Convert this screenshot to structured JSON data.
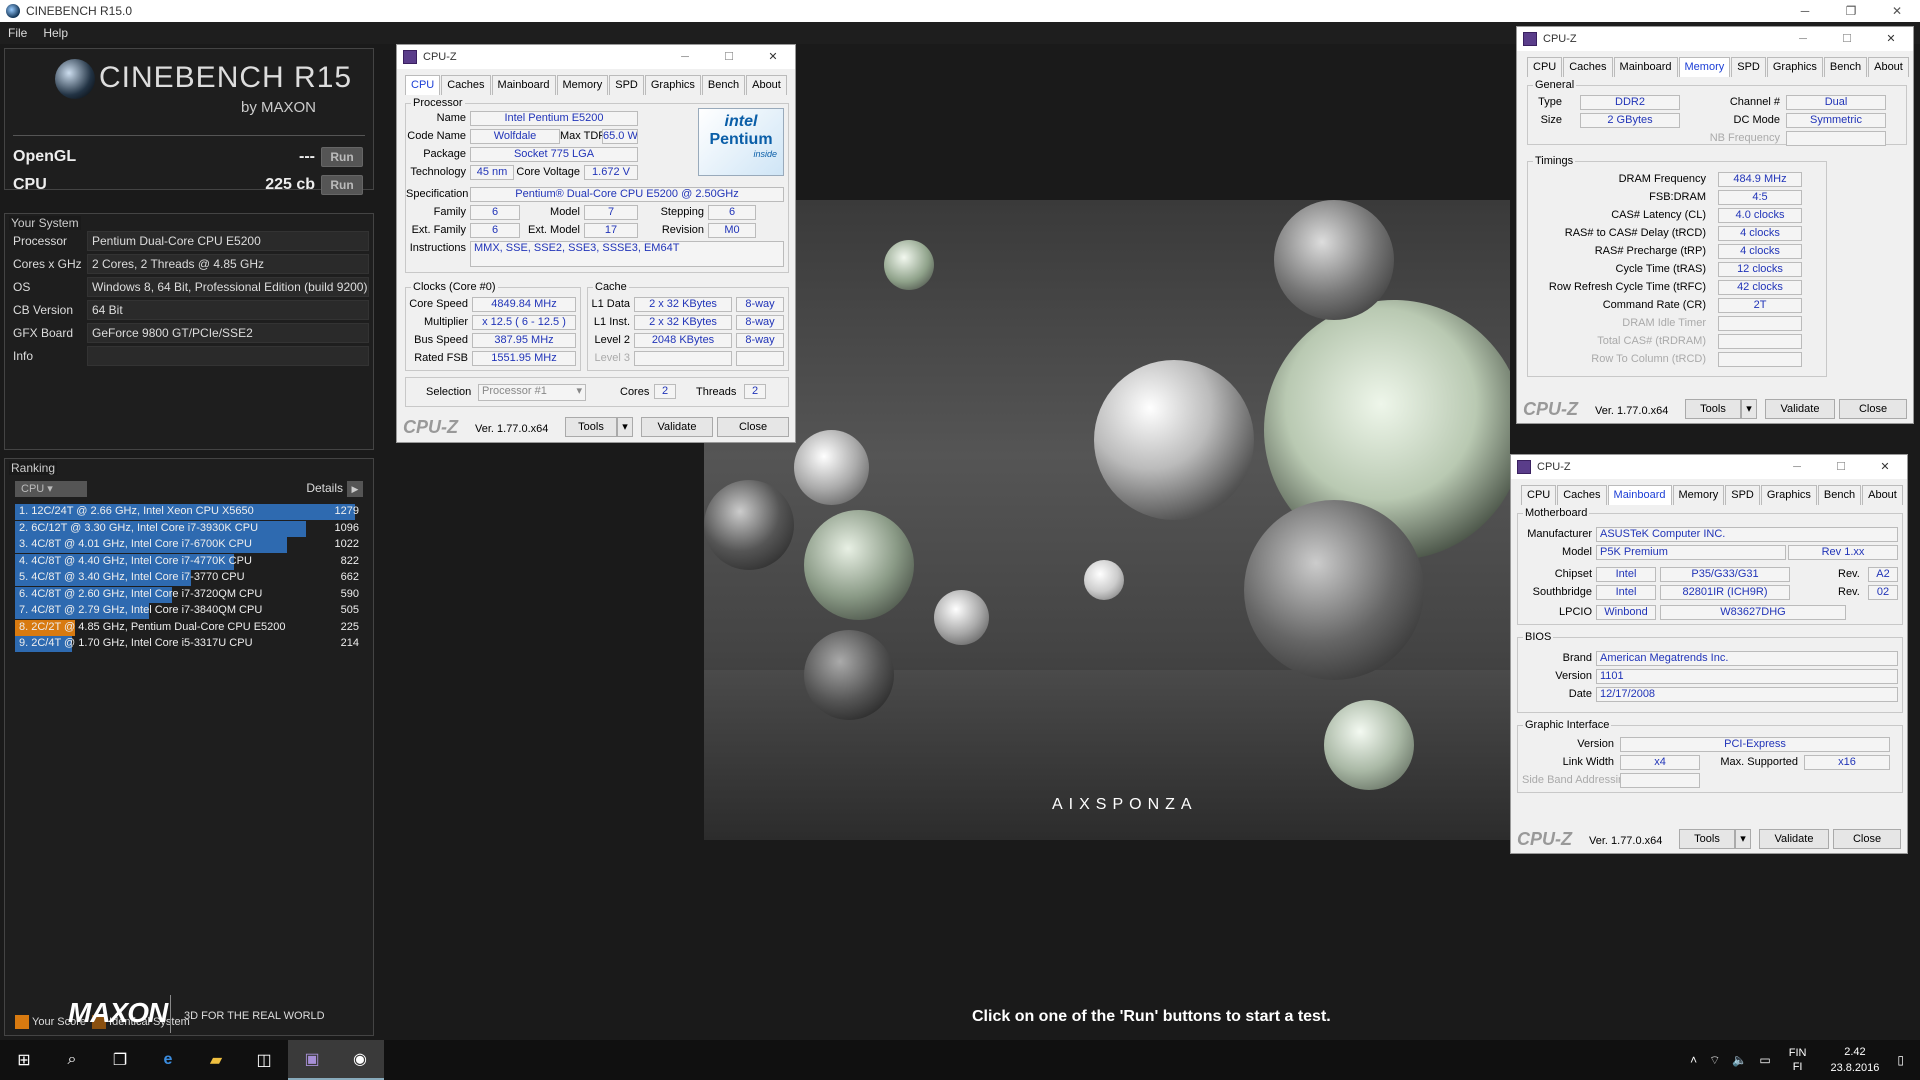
{
  "window_title": "CINEBENCH R15.0",
  "menu": [
    "File",
    "Help"
  ],
  "logo": {
    "name": "CINEBENCH R15",
    "by": "by MAXON"
  },
  "scores": [
    {
      "label": "OpenGL",
      "value": "---",
      "button": "Run"
    },
    {
      "label": "CPU",
      "value": "225 cb",
      "button": "Run"
    }
  ],
  "your_system": {
    "title": "Your System",
    "rows": [
      {
        "k": "Processor",
        "v": "Pentium Dual-Core CPU E5200"
      },
      {
        "k": "Cores x GHz",
        "v": "2 Cores, 2 Threads @ 4.85 GHz"
      },
      {
        "k": "OS",
        "v": "Windows 8, 64 Bit, Professional Edition (build 9200)"
      },
      {
        "k": "CB Version",
        "v": "64 Bit"
      },
      {
        "k": "GFX Board",
        "v": "GeForce 9800 GT/PCIe/SSE2"
      },
      {
        "k": "Info",
        "v": ""
      }
    ]
  },
  "ranking": {
    "title": "Ranking",
    "select": "CPU",
    "details": "Details",
    "max_score": 1279,
    "rows": [
      {
        "label": "1. 12C/24T @ 2.66 GHz, Intel Xeon CPU X5650",
        "score": 1279,
        "own": false
      },
      {
        "label": "2. 6C/12T @ 3.30 GHz,  Intel Core i7-3930K CPU",
        "score": 1096,
        "own": false
      },
      {
        "label": "3. 4C/8T @ 4.01 GHz, Intel Core i7-6700K CPU",
        "score": 1022,
        "own": false
      },
      {
        "label": "4. 4C/8T @ 4.40 GHz, Intel Core i7-4770K CPU",
        "score": 822,
        "own": false
      },
      {
        "label": "5. 4C/8T @ 3.40 GHz,  Intel Core i7-3770 CPU",
        "score": 662,
        "own": false
      },
      {
        "label": "6. 4C/8T @ 2.60 GHz, Intel Core i7-3720QM CPU",
        "score": 590,
        "own": false
      },
      {
        "label": "7. 4C/8T @ 2.79 GHz,  Intel Core i7-3840QM CPU",
        "score": 505,
        "own": false
      },
      {
        "label": "8. 2C/2T @ 4.85 GHz, Pentium Dual-Core CPU E5200",
        "score": 225,
        "own": true
      },
      {
        "label": "9. 2C/4T @ 1.70 GHz,  Intel Core i5-3317U CPU",
        "score": 214,
        "own": false
      }
    ],
    "legend": {
      "your_score": "Your Score",
      "identical": "Identical System",
      "your_color": "#d87a10",
      "identical_color": "#8a5010"
    }
  },
  "footer": {
    "brand": "MAXON",
    "tagline": "3D FOR THE REAL WORLD",
    "hint": "Click on one of the 'Run' buttons to start a test."
  },
  "render_brand": "AIXSPONZA",
  "cpuz_cpu": {
    "title": "CPU-Z",
    "tabs": [
      "CPU",
      "Caches",
      "Mainboard",
      "Memory",
      "SPD",
      "Graphics",
      "Bench",
      "About"
    ],
    "active_tab": "CPU",
    "processor": {
      "group": "Processor",
      "name": "Intel Pentium E5200",
      "code_name": "Wolfdale",
      "max_tdp": "65.0 W",
      "package": "Socket 775 LGA",
      "technology": "45 nm",
      "core_voltage": "1.672 V",
      "specification": "Pentium® Dual-Core  CPU     E5200  @ 2.50GHz",
      "family": "6",
      "model": "7",
      "stepping": "6",
      "ext_family": "6",
      "ext_model": "17",
      "revision": "M0",
      "instructions": "MMX, SSE, SSE2, SSE3, SSSE3, EM64T",
      "labels": {
        "name": "Name",
        "code_name": "Code Name",
        "max_tdp": "Max TDP",
        "package": "Package",
        "technology": "Technology",
        "core_voltage": "Core Voltage",
        "specification": "Specification",
        "family": "Family",
        "model": "Model",
        "stepping": "Stepping",
        "ext_family": "Ext. Family",
        "ext_model": "Ext. Model",
        "revision": "Revision",
        "instructions": "Instructions"
      },
      "logo": {
        "brand": "intel",
        "line": "Pentium",
        "sub": "inside"
      }
    },
    "clocks": {
      "group": "Clocks (Core #0)",
      "core_speed": "4849.84 MHz",
      "multiplier": "x 12.5 ( 6 - 12.5 )",
      "bus_speed": "387.95 MHz",
      "rated_fsb": "1551.95 MHz",
      "labels": {
        "core_speed": "Core Speed",
        "multiplier": "Multiplier",
        "bus_speed": "Bus Speed",
        "rated_fsb": "Rated FSB"
      }
    },
    "cache": {
      "group": "Cache",
      "rows": [
        {
          "k": "L1 Data",
          "v": "2 x 32 KBytes",
          "w": "8-way"
        },
        {
          "k": "L1 Inst.",
          "v": "2 x 32 KBytes",
          "w": "8-way"
        },
        {
          "k": "Level 2",
          "v": "2048 KBytes",
          "w": "8-way"
        },
        {
          "k": "Level 3",
          "v": "",
          "w": ""
        }
      ]
    },
    "selection": {
      "label": "Selection",
      "value": "Processor #1",
      "cores_label": "Cores",
      "cores": "2",
      "threads_label": "Threads",
      "threads": "2"
    },
    "bottom": {
      "logo": "CPU-Z",
      "version": "Ver. 1.77.0.x64",
      "tools": "Tools",
      "validate": "Validate",
      "close": "Close"
    }
  },
  "cpuz_mem": {
    "title": "CPU-Z",
    "tabs": [
      "CPU",
      "Caches",
      "Mainboard",
      "Memory",
      "SPD",
      "Graphics",
      "Bench",
      "About"
    ],
    "active_tab": "Memory",
    "general": {
      "group": "General",
      "type_label": "Type",
      "type": "DDR2",
      "size_label": "Size",
      "size": "2 GBytes",
      "channel_label": "Channel #",
      "channel": "Dual",
      "dc_label": "DC Mode",
      "dc": "Symmetric",
      "nb_label": "NB Frequency",
      "nb": ""
    },
    "timings": {
      "group": "Timings",
      "rows": [
        {
          "k": "DRAM Frequency",
          "v": "484.9 MHz",
          "dim": false
        },
        {
          "k": "FSB:DRAM",
          "v": "4:5",
          "dim": false
        },
        {
          "k": "CAS# Latency (CL)",
          "v": "4.0 clocks",
          "dim": false
        },
        {
          "k": "RAS# to CAS# Delay (tRCD)",
          "v": "4 clocks",
          "dim": false
        },
        {
          "k": "RAS# Precharge (tRP)",
          "v": "4 clocks",
          "dim": false
        },
        {
          "k": "Cycle Time (tRAS)",
          "v": "12 clocks",
          "dim": false
        },
        {
          "k": "Row Refresh Cycle Time (tRFC)",
          "v": "42 clocks",
          "dim": false
        },
        {
          "k": "Command Rate (CR)",
          "v": "2T",
          "dim": false
        },
        {
          "k": "DRAM Idle Timer",
          "v": "",
          "dim": true
        },
        {
          "k": "Total CAS# (tRDRAM)",
          "v": "",
          "dim": true
        },
        {
          "k": "Row To Column (tRCD)",
          "v": "",
          "dim": true
        }
      ]
    },
    "bottom": {
      "logo": "CPU-Z",
      "version": "Ver. 1.77.0.x64",
      "tools": "Tools",
      "validate": "Validate",
      "close": "Close"
    }
  },
  "cpuz_mb": {
    "title": "CPU-Z",
    "tabs": [
      "CPU",
      "Caches",
      "Mainboard",
      "Memory",
      "SPD",
      "Graphics",
      "Bench",
      "About"
    ],
    "active_tab": "Mainboard",
    "motherboard": {
      "group": "Motherboard",
      "manufacturer_label": "Manufacturer",
      "manufacturer": "ASUSTeK Computer INC.",
      "model_label": "Model",
      "model": "P5K Premium",
      "rev": "Rev 1.xx",
      "chipset_label": "Chipset",
      "chipset_vendor": "Intel",
      "chipset": "P35/G33/G31",
      "chipset_rev_label": "Rev.",
      "chipset_rev": "A2",
      "south_label": "Southbridge",
      "south_vendor": "Intel",
      "south": "82801IR (ICH9R)",
      "south_rev_label": "Rev.",
      "south_rev": "02",
      "lpcio_label": "LPCIO",
      "lpcio_vendor": "Winbond",
      "lpcio": "W83627DHG"
    },
    "bios": {
      "group": "BIOS",
      "brand_label": "Brand",
      "brand": "American Megatrends Inc.",
      "version_label": "Version",
      "version": "1101",
      "date_label": "Date",
      "date": "12/17/2008"
    },
    "graphic": {
      "group": "Graphic Interface",
      "version_label": "Version",
      "version": "PCI-Express",
      "lw_label": "Link Width",
      "lw": "x4",
      "max_label": "Max. Supported",
      "max": "x16",
      "sba_label": "Side Band Addressing",
      "sba": ""
    },
    "bottom": {
      "logo": "CPU-Z",
      "version": "Ver. 1.77.0.x64",
      "tools": "Tools",
      "validate": "Validate",
      "close": "Close"
    }
  },
  "taskbar": {
    "lang1": "FIN",
    "lang2": "FI",
    "time": "2.42",
    "date": "23.8.2016"
  }
}
